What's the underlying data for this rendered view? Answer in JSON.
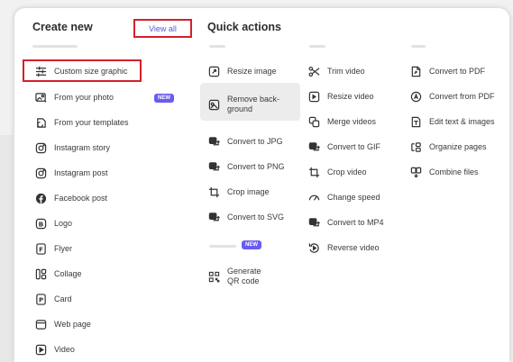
{
  "create_new": {
    "title": "Create new",
    "view_all": "View all",
    "items": [
      {
        "label": "Custom size graphic",
        "icon": "sliders-icon"
      },
      {
        "label": "From your photo",
        "icon": "photo-magic-icon",
        "badge": "NEW"
      },
      {
        "label": "From your templates",
        "icon": "templates-icon"
      },
      {
        "label": "Instagram story",
        "icon": "instagram-icon"
      },
      {
        "label": "Instagram post",
        "icon": "instagram-icon"
      },
      {
        "label": "Facebook post",
        "icon": "facebook-icon"
      },
      {
        "label": "Logo",
        "icon": "logo-b-icon"
      },
      {
        "label": "Flyer",
        "icon": "flyer-icon"
      },
      {
        "label": "Collage",
        "icon": "collage-icon"
      },
      {
        "label": "Card",
        "icon": "card-icon"
      },
      {
        "label": "Web page",
        "icon": "web-page-icon"
      },
      {
        "label": "Video",
        "icon": "video-play-icon"
      }
    ]
  },
  "quick_actions": {
    "title": "Quick actions",
    "image": [
      {
        "label": "Resize image",
        "icon": "resize-image-icon"
      },
      {
        "label": "Remove back-ground",
        "icon": "remove-background-icon"
      },
      {
        "label": "Convert to JPG",
        "icon": "convert-image-icon"
      },
      {
        "label": "Convert to PNG",
        "icon": "convert-image-icon"
      },
      {
        "label": "Crop image",
        "icon": "crop-icon"
      },
      {
        "label": "Convert to SVG",
        "icon": "convert-image-icon"
      }
    ],
    "extra_badge": "NEW",
    "qr": {
      "label": "Generate QR code",
      "icon": "qr-code-icon"
    },
    "video": [
      {
        "label": "Trim video",
        "icon": "scissors-icon"
      },
      {
        "label": "Resize video",
        "icon": "resize-video-icon"
      },
      {
        "label": "Merge videos",
        "icon": "merge-videos-icon"
      },
      {
        "label": "Convert to GIF",
        "icon": "convert-gif-icon"
      },
      {
        "label": "Crop video",
        "icon": "crop-icon"
      },
      {
        "label": "Change speed",
        "icon": "speed-icon"
      },
      {
        "label": "Convert to MP4",
        "icon": "convert-mp4-icon"
      },
      {
        "label": "Reverse video",
        "icon": "reverse-video-icon"
      }
    ],
    "document": [
      {
        "label": "Convert to PDF",
        "icon": "convert-pdf-icon"
      },
      {
        "label": "Convert from PDF",
        "icon": "convert-from-pdf-icon"
      },
      {
        "label": "Edit text & images",
        "icon": "edit-text-icon"
      },
      {
        "label": "Organize pages",
        "icon": "organize-pages-icon"
      },
      {
        "label": "Combine files",
        "icon": "combine-files-icon"
      }
    ]
  },
  "colors": {
    "accent_red": "#d4202a",
    "link_blue": "#5558d9",
    "badge_purple": "#6a5cf0"
  }
}
